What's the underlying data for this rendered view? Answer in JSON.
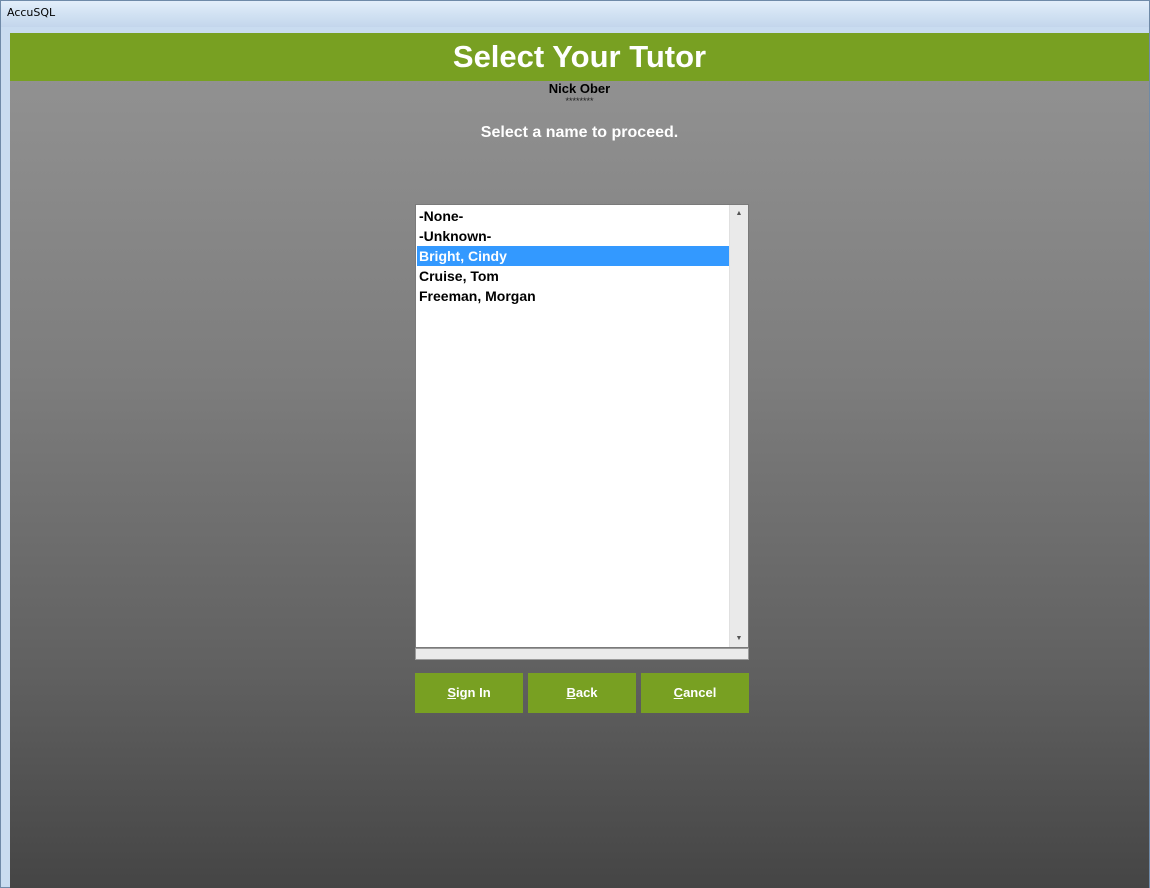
{
  "window": {
    "title": "AccuSQL"
  },
  "header": {
    "title": "Select Your Tutor",
    "user_name": "Nick  Ober",
    "masked_password": "********"
  },
  "instruction": "Select a name to proceed.",
  "tutor_list": {
    "items": [
      {
        "label": "-None-",
        "selected": false
      },
      {
        "label": "-Unknown-",
        "selected": false
      },
      {
        "label": "Bright, Cindy",
        "selected": true
      },
      {
        "label": "Cruise, Tom",
        "selected": false
      },
      {
        "label": "Freeman, Morgan",
        "selected": false
      }
    ],
    "scroll_up_icon": "triangle-up",
    "scroll_down_icon": "triangle-down"
  },
  "buttons": {
    "sign_in": {
      "accel": "S",
      "rest": "ign In"
    },
    "back": {
      "accel": "B",
      "rest": "ack"
    },
    "cancel": {
      "accel": "C",
      "rest": "ancel"
    }
  },
  "colors": {
    "accent_green": "#78a022",
    "selection_blue": "#3399ff"
  }
}
